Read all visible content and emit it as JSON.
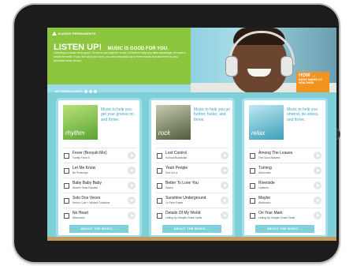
{
  "header": {
    "brand": "KAISER PERMANENTE",
    "headline": "LISTEN UP!",
    "subheadline": "MUSIC IS GOOD FOR YOU.",
    "intro": "Listening to music feels good. So we've put together a mix of tunes to help you take advantage of music's health benefits. If you like what you hear, you can download up to three tracks and add them to your personal music library.",
    "downloads_label": "MY DOWNLOADS:",
    "how_badge_title": "HOW →",
    "how_badge_text": "MUSIC MAKES US HEALTHIER"
  },
  "cards": [
    {
      "cover_label": "rhythm",
      "cover_color": "#8cc63f",
      "tagline": "Music to help you get your groove on, and thrive.",
      "tracks": [
        {
          "title": "Fever (Booyah Mix)",
          "artist": "Family Force 5"
        },
        {
          "title": "Let Me Know",
          "artist": "Be Periscope"
        },
        {
          "title": "Baby Baby Baby",
          "artist": "Warren Dean Flandez"
        },
        {
          "title": "Solo Dos Veces",
          "artist": "Hermo Cole + Wicked Collective"
        },
        {
          "title": "No Heart",
          "artist": "Aficionado"
        }
      ],
      "about": "ABOUT THE MUSIC →"
    },
    {
      "cover_label": "rock",
      "cover_color": "#6a7f5a",
      "tagline": "Music to help you go further, faster, and thrive.",
      "tracks": [
        {
          "title": "Lost Control",
          "artist": "Korhaul Broadcast"
        },
        {
          "title": "Yeah People",
          "artist": "Doit La La"
        },
        {
          "title": "Better To Love You",
          "artist": "Daeno"
        },
        {
          "title": "Sunshine Underground",
          "artist": "Le Fleur Fatale"
        },
        {
          "title": "Details Of My World",
          "artist": "Letting Up Despite Great Faults"
        }
      ],
      "about": "ABOUT THE MUSIC →"
    },
    {
      "cover_label": "relax",
      "cover_color": "#4fb3c9",
      "tagline": "Music to help you unwind, de-stress, and thrive.",
      "tracks": [
        {
          "title": "Among The Leaves",
          "artist": "The Good Natures"
        },
        {
          "title": "Turning",
          "artist": "Aficionado"
        },
        {
          "title": "Riverside",
          "artist": "Lanterns"
        },
        {
          "title": "Maybe",
          "artist": "Aficionado"
        },
        {
          "title": "On Your Mark",
          "artist": "Letting Up Despite Great Faults"
        }
      ],
      "about": "ABOUT THE MUSIC →"
    }
  ]
}
